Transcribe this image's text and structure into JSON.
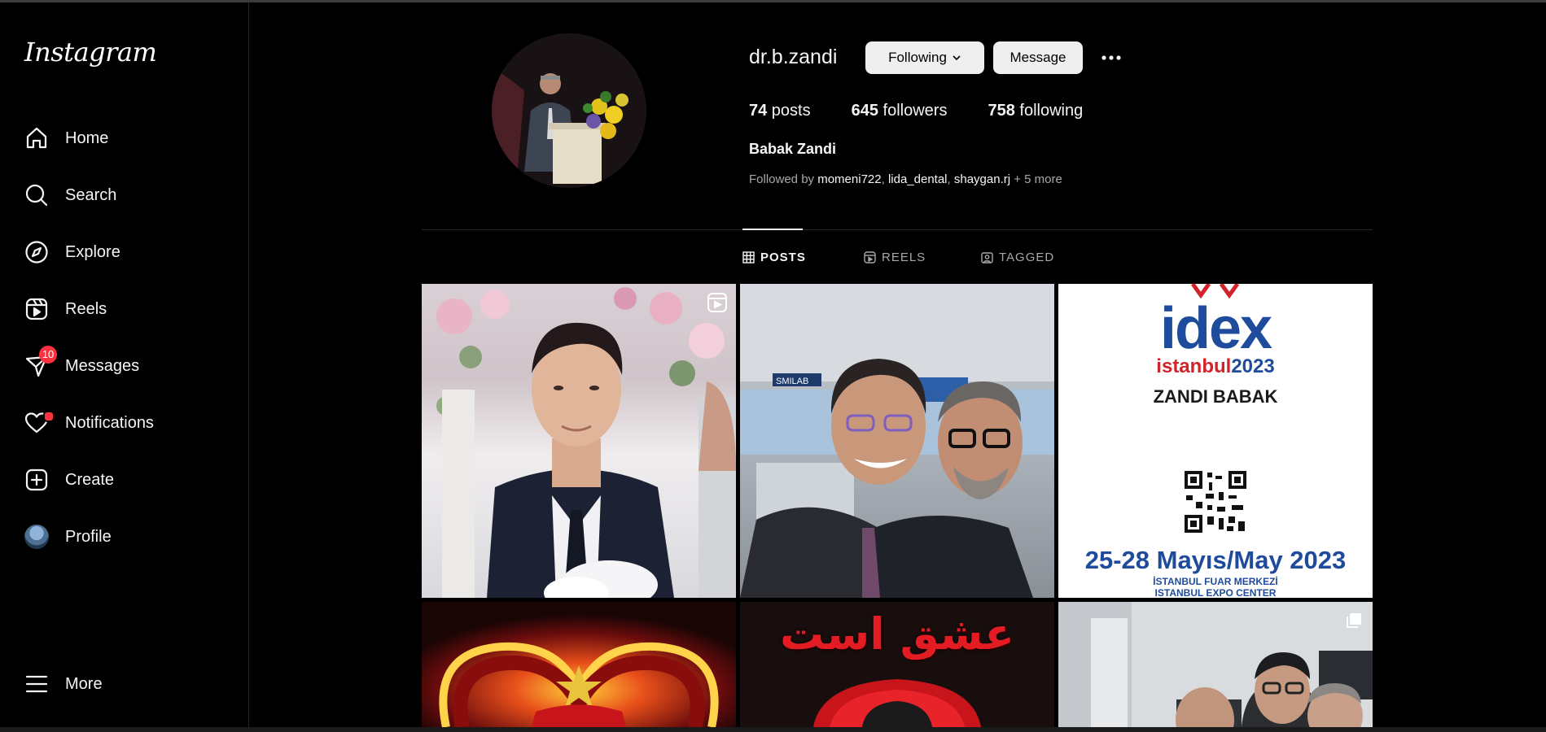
{
  "sidebar": {
    "logo": "Instagram",
    "items": [
      {
        "label": "Home",
        "icon": "home-icon"
      },
      {
        "label": "Search",
        "icon": "search-icon"
      },
      {
        "label": "Explore",
        "icon": "compass-icon"
      },
      {
        "label": "Reels",
        "icon": "reels-icon"
      },
      {
        "label": "Messages",
        "icon": "messenger-icon",
        "badge": "10"
      },
      {
        "label": "Notifications",
        "icon": "heart-icon"
      },
      {
        "label": "Create",
        "icon": "plus-square-icon"
      },
      {
        "label": "Profile",
        "icon": "avatar"
      },
      {
        "label": "More",
        "icon": "hamburger-icon"
      }
    ]
  },
  "profile": {
    "username": "dr.b.zandi",
    "following_button": "Following",
    "message_button": "Message",
    "posts_count": "74",
    "posts_label": " posts",
    "followers_count": "645",
    "followers_label": " followers",
    "following_count": "758",
    "following_label": " following",
    "full_name": "Babak Zandi",
    "followed_by_prefix": "Followed by ",
    "followed_by_accounts": [
      "momeni722",
      "lida_dental",
      "shaygan.rj"
    ],
    "followed_by_suffix": " + 5 more"
  },
  "tabs": [
    {
      "label": "POSTS",
      "icon": "grid-icon",
      "active": true
    },
    {
      "label": "REELS",
      "icon": "reels-small-icon",
      "active": false
    },
    {
      "label": "TAGGED",
      "icon": "tagged-icon",
      "active": false
    }
  ],
  "posts": {
    "poster": {
      "brand": "idex",
      "city": "istanbul",
      "year": "2023",
      "name": "ZANDI BABAK",
      "dates": "25-28 Mayıs/May 2023",
      "venue_tr": "İSTANBUL FUAR MERKEZİ",
      "venue_en": "ISTANBUL EXPO CENTER"
    },
    "arabic_text": "عشق است"
  },
  "colors": {
    "background": "#000000",
    "badge": "#ff3040",
    "button_bg": "#efefef",
    "muted_text": "#a8a8a8"
  }
}
